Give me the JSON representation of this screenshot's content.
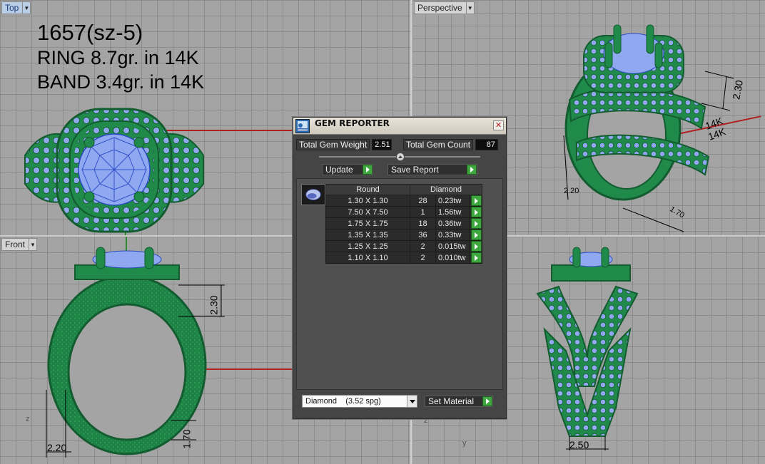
{
  "viewports": {
    "top": {
      "label": "Top"
    },
    "perspective": {
      "label": "Perspective"
    },
    "front": {
      "label": "Front"
    }
  },
  "notes": {
    "line1": "1657(sz-5)",
    "line2": "RING 8.7gr. in 14K",
    "line3": "BAND 3.4gr.  in 14K"
  },
  "dimensions": {
    "front_height_a": "2.30",
    "front_height_b": "1.70",
    "front_width": "2.20",
    "right_width": "2.50",
    "persp_a": "2.30",
    "persp_b": "2.20",
    "persp_c": "1.70",
    "persp_text1": "14K",
    "persp_text2": "14K"
  },
  "axis_labels": {
    "z1": "z",
    "z2": "z",
    "y": "y"
  },
  "gem_reporter": {
    "title": "GEM REPORTER",
    "total_weight_label": "Total Gem Weight",
    "total_weight_value": "2.51",
    "total_count_label": "Total Gem Count",
    "total_count_value": "87",
    "update_label": "Update",
    "save_report_label": "Save Report",
    "table": {
      "col_shape": "Round",
      "col_material": "Diamond",
      "rows": [
        {
          "size": "1.30 X 1.30",
          "count": "28",
          "weight": "0.23tw"
        },
        {
          "size": "7.50 X 7.50",
          "count": "1",
          "weight": "1.56tw"
        },
        {
          "size": "1.75 X 1.75",
          "count": "18",
          "weight": "0.36tw"
        },
        {
          "size": "1.35 X 1.35",
          "count": "36",
          "weight": "0.33tw"
        },
        {
          "size": "1.25 X 1.25",
          "count": "2",
          "weight": "0.015tw"
        },
        {
          "size": "1.10 X 1.10",
          "count": "2",
          "weight": "0.010tw"
        }
      ]
    },
    "material_select": "Diamond    (3.52 spg)",
    "set_material_label": "Set Material"
  },
  "colors": {
    "ring_green": "#1f8a4a",
    "gem_blue": "#8fa8f0",
    "accent_go": "#3ea73e"
  }
}
